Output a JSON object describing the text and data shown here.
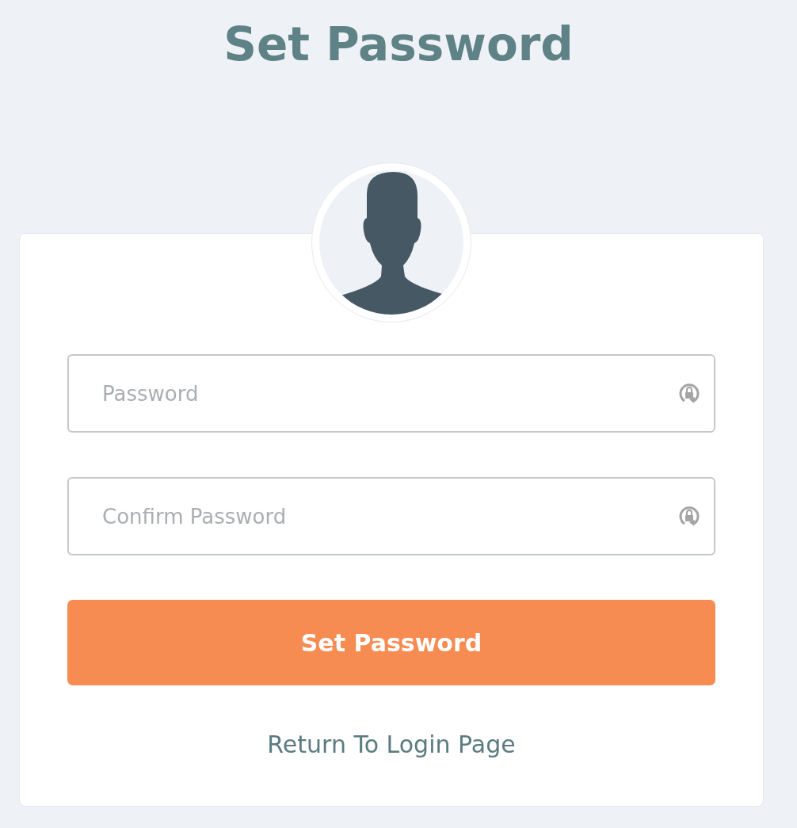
{
  "title": "Set Password",
  "fields": [
    {
      "placeholder": "Password"
    },
    {
      "placeholder": "Confirm Password"
    }
  ],
  "submit": "Set Password",
  "link": "Return To Login Page"
}
